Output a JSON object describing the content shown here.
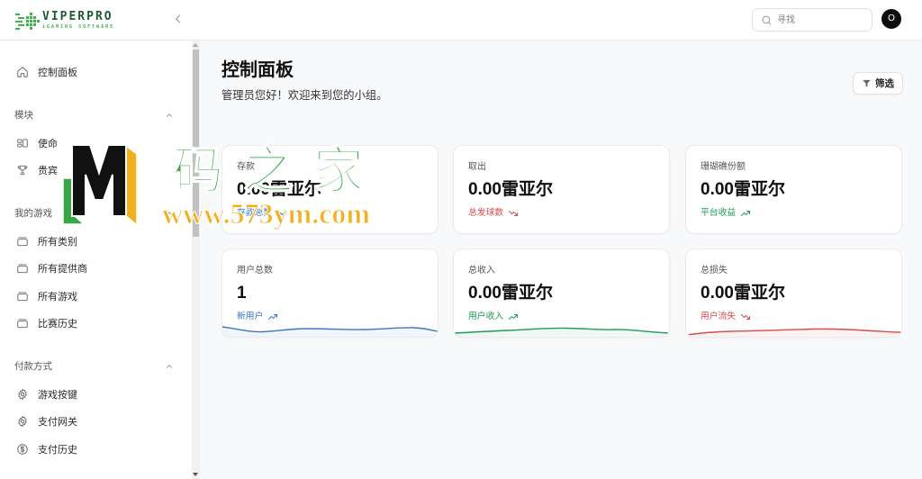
{
  "app": {
    "brand": "VIPERPRO",
    "tagline": "iGAMING SOFTWARE",
    "logo_icon": "viper-pixel-logo-icon"
  },
  "header": {
    "collapse_icon": "chevron-left-icon",
    "search": {
      "placeholder": "寻找",
      "value": "",
      "icon": "search-icon"
    },
    "avatar_initial": "O"
  },
  "sidebar": {
    "dashboard": {
      "label": "控制面板",
      "icon": "home-icon"
    },
    "sections": [
      {
        "title": "模块",
        "toggle_icon": "chevron-up-icon",
        "items": [
          {
            "label": "使命",
            "icon": "missions-icon"
          },
          {
            "label": "贵宾",
            "icon": "trophy-icon"
          }
        ]
      },
      {
        "title": "我的游戏",
        "toggle_icon": "chevron-up-icon",
        "items": [
          {
            "label": "所有类别",
            "icon": "stack-icon"
          },
          {
            "label": "所有提供商",
            "icon": "stack-icon"
          },
          {
            "label": "所有游戏",
            "icon": "stack-icon"
          },
          {
            "label": "比赛历史",
            "icon": "stack-icon"
          }
        ]
      },
      {
        "title": "付款方式",
        "toggle_icon": "chevron-up-icon",
        "items": [
          {
            "label": "游戏按键",
            "icon": "gear-icon"
          },
          {
            "label": "支付网关",
            "icon": "gear-icon"
          },
          {
            "label": "支付历史",
            "icon": "dollar-circle-icon"
          }
        ]
      }
    ]
  },
  "page": {
    "title": "控制面板",
    "subtitle": "管理员您好！欢迎来到您的小组。",
    "filter": {
      "label": "筛选",
      "icon": "funnel-icon"
    }
  },
  "stats": [
    {
      "label": "存款",
      "value": "0.00雷亚尔",
      "caption": "存款总数",
      "trend_icon": "trending-up-icon",
      "tone_color": "#3d78c2"
    },
    {
      "label": "取出",
      "value": "0.00雷亚尔",
      "caption": "总发球数",
      "trend_icon": "trending-down-icon",
      "tone_color": "#d94b4b"
    },
    {
      "label": "珊瑚礁份额",
      "value": "0.00雷亚尔",
      "caption": "平台收益",
      "trend_icon": "trending-up-icon",
      "tone_color": "#1f9a57"
    },
    {
      "label": "用户总数",
      "value": "1",
      "caption": "新用户",
      "trend_icon": "trending-up-icon",
      "tone_color": "#3d78c2"
    },
    {
      "label": "总收入",
      "value": "0.00雷亚尔",
      "caption": "用户收入",
      "trend_icon": "trending-up-icon",
      "tone_color": "#1f9a57"
    },
    {
      "label": "总损失",
      "value": "0.00雷亚尔",
      "caption": "用户流失",
      "trend_icon": "trending-down-icon",
      "tone_color": "#d94b4b"
    }
  ],
  "colors": {
    "brand": "#3db54a",
    "brand_text": "#1e5a35",
    "avatar": "#0d0d0d",
    "watermark_green": "#37a645",
    "watermark_yellow": "#f2b01e"
  },
  "watermark": {
    "title": "码之家",
    "site": "www.573ym.com"
  }
}
